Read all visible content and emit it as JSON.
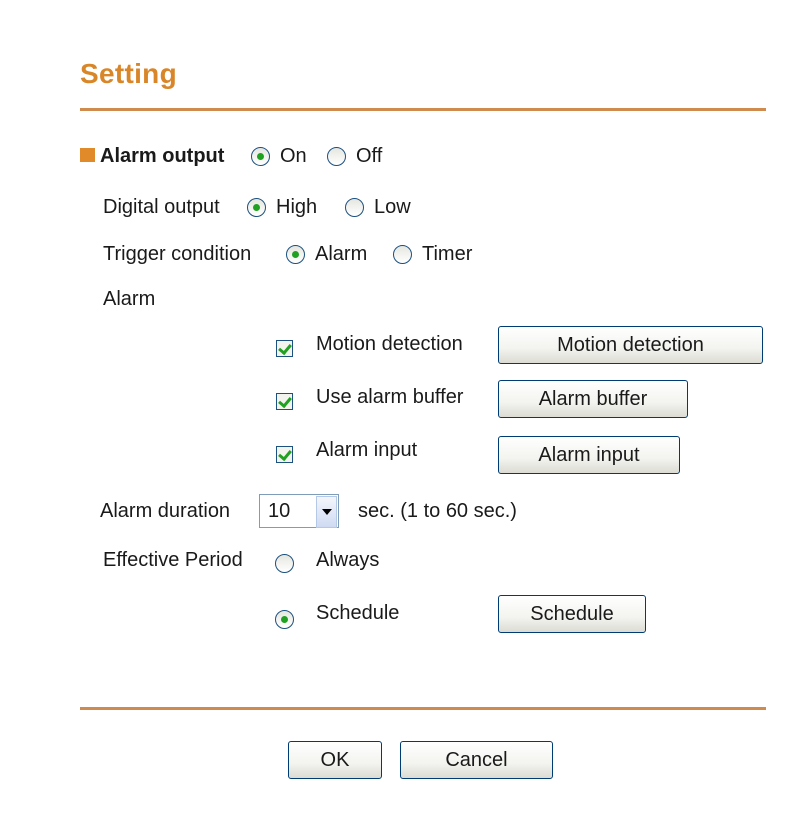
{
  "page": {
    "title": "Setting"
  },
  "alarm_output": {
    "label": "Alarm output",
    "on_label": "On",
    "off_label": "Off",
    "selected": "On"
  },
  "digital_output": {
    "label": "Digital output",
    "high_label": "High",
    "low_label": "Low",
    "selected": "High"
  },
  "trigger_condition": {
    "label": "Trigger condition",
    "alarm_label": "Alarm",
    "timer_label": "Timer",
    "selected": "Alarm"
  },
  "alarm": {
    "label": "Alarm",
    "motion_detection": {
      "checkbox_label": "Motion detection",
      "checked": true,
      "button_label": "Motion detection"
    },
    "alarm_buffer": {
      "checkbox_label": "Use alarm buffer",
      "checked": true,
      "button_label": "Alarm buffer"
    },
    "alarm_input": {
      "checkbox_label": "Alarm input",
      "checked": true,
      "button_label": "Alarm input"
    }
  },
  "alarm_duration": {
    "label": "Alarm duration",
    "value": "10",
    "suffix": "sec. (1 to 60 sec.)"
  },
  "effective_period": {
    "label": "Effective Period",
    "always_label": "Always",
    "schedule_label": "Schedule",
    "selected": "Schedule",
    "schedule_button_label": "Schedule"
  },
  "footer": {
    "ok_label": "OK",
    "cancel_label": "Cancel"
  },
  "colors": {
    "accent": "#d98628",
    "rule": "#cf8a4e",
    "check_green": "#21a121"
  }
}
